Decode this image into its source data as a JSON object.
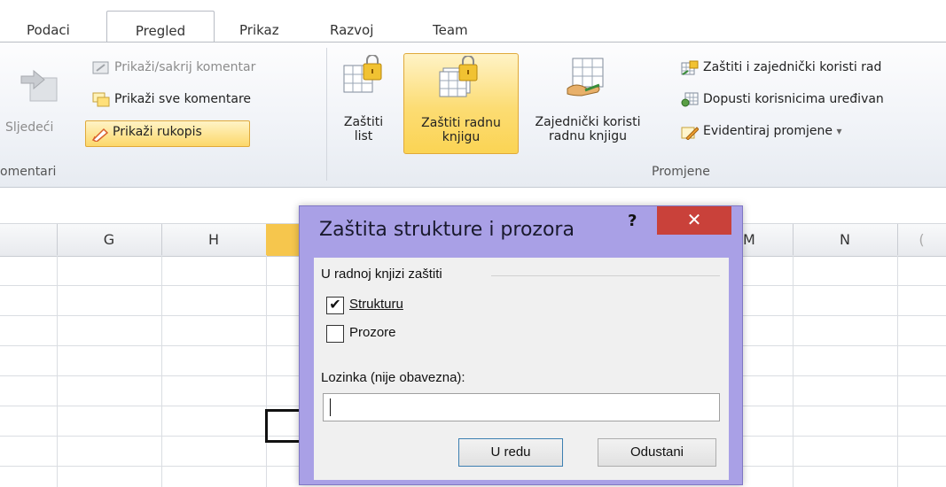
{
  "tabs": [
    "Podaci",
    "Pregled",
    "Prikaz",
    "Razvoj",
    "Team"
  ],
  "active_tab": "Pregled",
  "ribbon": {
    "comments_group": {
      "next_label": "Sljedeći",
      "show_hide_comment": "Prikaži/sakrij komentar",
      "show_all_comments": "Prikaži sve komentare",
      "show_ink": "Prikaži rukopis",
      "group_label": "omentari"
    },
    "changes_group": {
      "protect_sheet": [
        "Zaštiti",
        "list"
      ],
      "protect_workbook": [
        "Zaštiti radnu",
        "knjigu"
      ],
      "share_workbook": [
        "Zajednički koristi",
        "radnu knjigu"
      ],
      "protect_and_share": "Zaštiti i zajednički koristi rad",
      "allow_users_edit": "Dopusti korisnicima uređivan",
      "track_changes": "Evidentiraj promjene",
      "track_changes_arrow": "▾",
      "group_label": "Promjene"
    }
  },
  "sheet": {
    "columns": [
      "",
      "G",
      "H",
      "",
      "M",
      "N",
      "("
    ]
  },
  "dialog": {
    "title": "Zaštita strukture i prozora",
    "help": "?",
    "close": "✕",
    "section_label": "U radnoj knjizi zaštiti",
    "structure_label": "Strukturu",
    "structure_checked": true,
    "windows_label": "Prozore",
    "windows_checked": false,
    "password_label": "Lozinka (nije obavezna):",
    "password_value": "",
    "ok_label": "U redu",
    "cancel_label": "Odustani"
  },
  "colors": {
    "dialog_frame": "#a9a0e6",
    "close_button": "#c9413a",
    "active_button": "#fbd454",
    "selected_column": "#f6c64d"
  }
}
